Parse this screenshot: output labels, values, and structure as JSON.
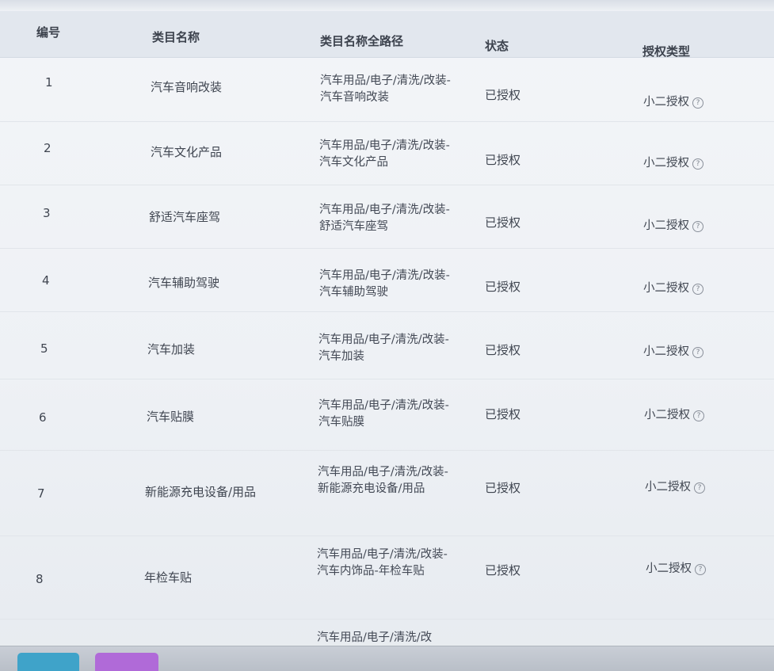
{
  "table": {
    "headers": {
      "id": "编号",
      "name": "类目名称",
      "path": "类目名称全路径",
      "status": "状态",
      "auth_type": "授权类型"
    },
    "rows": [
      {
        "id": "1",
        "name": "汽车音响改装",
        "path": "汽车用品/电子/清洗/改装-汽车音响改装",
        "status": "已授权",
        "auth": "小二授权"
      },
      {
        "id": "2",
        "name": "汽车文化产品",
        "path": "汽车用品/电子/清洗/改装-汽车文化产品",
        "status": "已授权",
        "auth": "小二授权"
      },
      {
        "id": "3",
        "name": "舒适汽车座驾",
        "path": "汽车用品/电子/清洗/改装-舒适汽车座驾",
        "status": "已授权",
        "auth": "小二授权"
      },
      {
        "id": "4",
        "name": "汽车辅助驾驶",
        "path": "汽车用品/电子/清洗/改装-汽车辅助驾驶",
        "status": "已授权",
        "auth": "小二授权"
      },
      {
        "id": "5",
        "name": "汽车加装",
        "path": "汽车用品/电子/清洗/改装-汽车加装",
        "status": "已授权",
        "auth": "小二授权"
      },
      {
        "id": "6",
        "name": "汽车贴膜",
        "path": "汽车用品/电子/清洗/改装-汽车贴膜",
        "status": "已授权",
        "auth": "小二授权"
      },
      {
        "id": "7",
        "name": "新能源充电设备/用品",
        "path": "汽车用品/电子/清洗/改装-新能源充电设备/用品",
        "status": "已授权",
        "auth": "小二授权"
      },
      {
        "id": "8",
        "name": "年检车贴",
        "path": "汽车用品/电子/清洗/改装-汽车内饰品-年检车贴",
        "status": "已授权",
        "auth": "小二授权"
      },
      {
        "id": "",
        "name": "",
        "path": "汽车用品/电子/清洗/改",
        "status": "",
        "auth": ""
      }
    ],
    "help_icon": "?"
  },
  "icons": {
    "help": "question-circle-icon",
    "taskbar_app_1": "taskbar-app-icon",
    "taskbar_app_2": "taskbar-app-icon"
  },
  "colors": {
    "header_bg": "#e2e7ee",
    "taskbar_app_1": "#3fa3c9",
    "taskbar_app_2": "#b06ad8"
  }
}
